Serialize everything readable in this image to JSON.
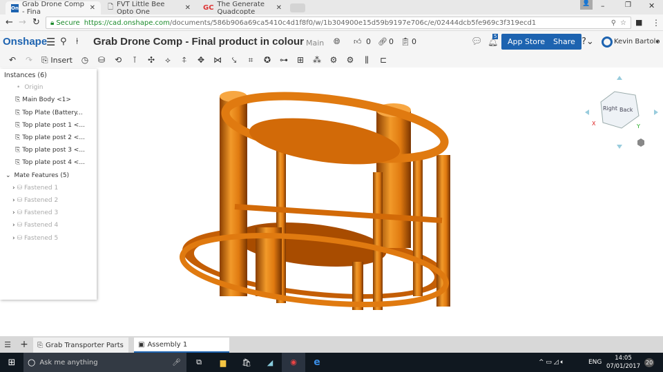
{
  "browser": {
    "tabs": [
      {
        "label": "Grab Drone Comp - Fina",
        "favicon": "On"
      },
      {
        "label": "FVT Little Bee Opto One",
        "favicon": "doc"
      },
      {
        "label": "The Generate Quadcopte",
        "favicon": "GC"
      }
    ],
    "secure_label": "Secure",
    "url_host": "https://cad.onshape.com",
    "url_path": "/documents/586b906a69ca5410c4d1f8f0/w/1b304900e15d59b9197e706c/e/02444dcb5fe969c3f319ecd1"
  },
  "app": {
    "logo": "Onshape",
    "doc_title": "Grab Drone Comp - Final product in colour",
    "branch": "Main",
    "likes": "0",
    "links": "0",
    "copies": "0",
    "notifications": "5",
    "app_store": "App Store",
    "share": "Share",
    "user": "Kevin Bartolo"
  },
  "toolbar": {
    "insert": "Insert"
  },
  "tree": {
    "instances_header": "Instances (6)",
    "origin": "Origin",
    "instances": [
      "Main Body <1>",
      "Top Plate (Battery...",
      "Top plate post 1 <...",
      "Top plate post 2 <...",
      "Top plate post 3 <...",
      "Top plate post 4 <..."
    ],
    "mates_header": "Mate Features (5)",
    "mates": [
      "Fastened 1",
      "Fastened 2",
      "Fastened 3",
      "Fastened 4",
      "Fastened 5"
    ]
  },
  "viewcube": {
    "right": "Right",
    "back": "Back",
    "x": "X",
    "y": "Y"
  },
  "bottom_tabs": [
    {
      "label": "Grab Transporter Parts"
    },
    {
      "label": "Assembly 1"
    }
  ],
  "taskbar": {
    "search": "Ask me anything",
    "lang": "ENG",
    "time": "14:05",
    "date": "07/01/2017",
    "notif": "20"
  },
  "colors": {
    "accent": "#1d63b0",
    "model": "#e07a10"
  }
}
